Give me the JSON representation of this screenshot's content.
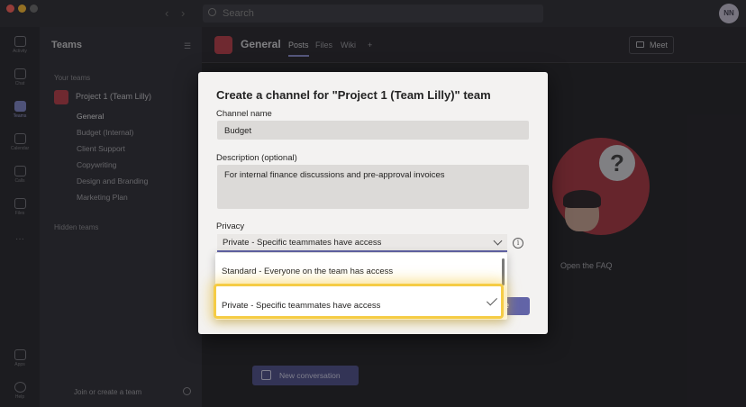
{
  "titlebar": {
    "search_placeholder": "Search",
    "avatar_initials": "NN"
  },
  "rail": {
    "items": [
      {
        "label": "Activity",
        "icon": "bell-icon"
      },
      {
        "label": "Chat",
        "icon": "chat-icon"
      },
      {
        "label": "Teams",
        "icon": "teams-icon"
      },
      {
        "label": "Calendar",
        "icon": "calendar-icon"
      },
      {
        "label": "Calls",
        "icon": "phone-icon"
      },
      {
        "label": "Files",
        "icon": "file-icon"
      }
    ],
    "bottom_items": [
      {
        "label": "Apps",
        "icon": "apps-icon"
      },
      {
        "label": "Help",
        "icon": "help-icon"
      }
    ]
  },
  "sidebar": {
    "title": "Teams",
    "your_teams_label": "Your teams",
    "team_name": "Project 1 (Team Lilly)",
    "channels": [
      "General",
      "Budget (Internal)",
      "Client Support",
      "Copywriting",
      "Design and Branding",
      "Marketing Plan"
    ],
    "hidden_teams_label": "Hidden teams",
    "join_label": "Join or create a team"
  },
  "main": {
    "channel_title": "General",
    "tabs": [
      "Posts",
      "Files",
      "Wiki"
    ],
    "add_tab": "+",
    "meet_label": "Meet",
    "faq_label": "Open the FAQ",
    "new_conversation_label": "New conversation"
  },
  "dialog": {
    "title": "Create a channel for \"Project 1 (Team Lilly)\" team",
    "channel_name_label": "Channel name",
    "channel_name_value": "Budget",
    "description_label": "Description (optional)",
    "description_value": "For internal finance discussions and pre-approval invoices",
    "privacy_label": "Privacy",
    "privacy_selected": "Private - Specific teammates have access",
    "info_glyph": "i",
    "create_label": "e",
    "options": [
      "Standard - Everyone on the team has access",
      "Private - Specific teammates have access"
    ]
  },
  "colors": {
    "accent": "#6264a7",
    "highlight": "#f5cc45",
    "team_tile": "#bb3b45"
  }
}
